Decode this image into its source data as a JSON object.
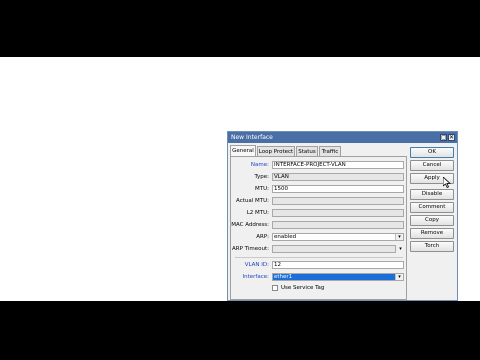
{
  "window": {
    "title": "New Interface",
    "minimize": "▢",
    "close": "✕"
  },
  "tabs": [
    {
      "label": "General"
    },
    {
      "label": "Loop Protect"
    },
    {
      "label": "Status"
    },
    {
      "label": "Traffic"
    }
  ],
  "form": {
    "name_label": "Name:",
    "name_value": "INTERFACE-PROJECT-VLAN",
    "type_label": "Type:",
    "type_value": "VLAN",
    "mtu_label": "MTU:",
    "mtu_value": "1500",
    "actual_mtu_label": "Actual MTU:",
    "actual_mtu_value": "",
    "l2mtu_label": "L2 MTU:",
    "l2mtu_value": "",
    "mac_label": "MAC Address:",
    "mac_value": "",
    "arp_label": "ARP:",
    "arp_value": "enabled",
    "arp_timeout_label": "ARP Timeout:",
    "arp_timeout_value": "",
    "vlan_id_label": "VLAN ID:",
    "vlan_id_value": "12",
    "interface_label": "Interface:",
    "interface_value": "ether1",
    "service_tag_label": "Use Service Tag",
    "dropdown_glyph": "▾"
  },
  "buttons": {
    "ok": "OK",
    "cancel": "Cancel",
    "apply": "Apply",
    "disable": "Disable",
    "comment": "Comment",
    "copy": "Copy",
    "remove": "Remove",
    "torch": "Torch"
  },
  "colors": {
    "titlebar": "#4a6fa6",
    "label_blue": "#1c3fbf",
    "selection": "#1c6fd8"
  }
}
